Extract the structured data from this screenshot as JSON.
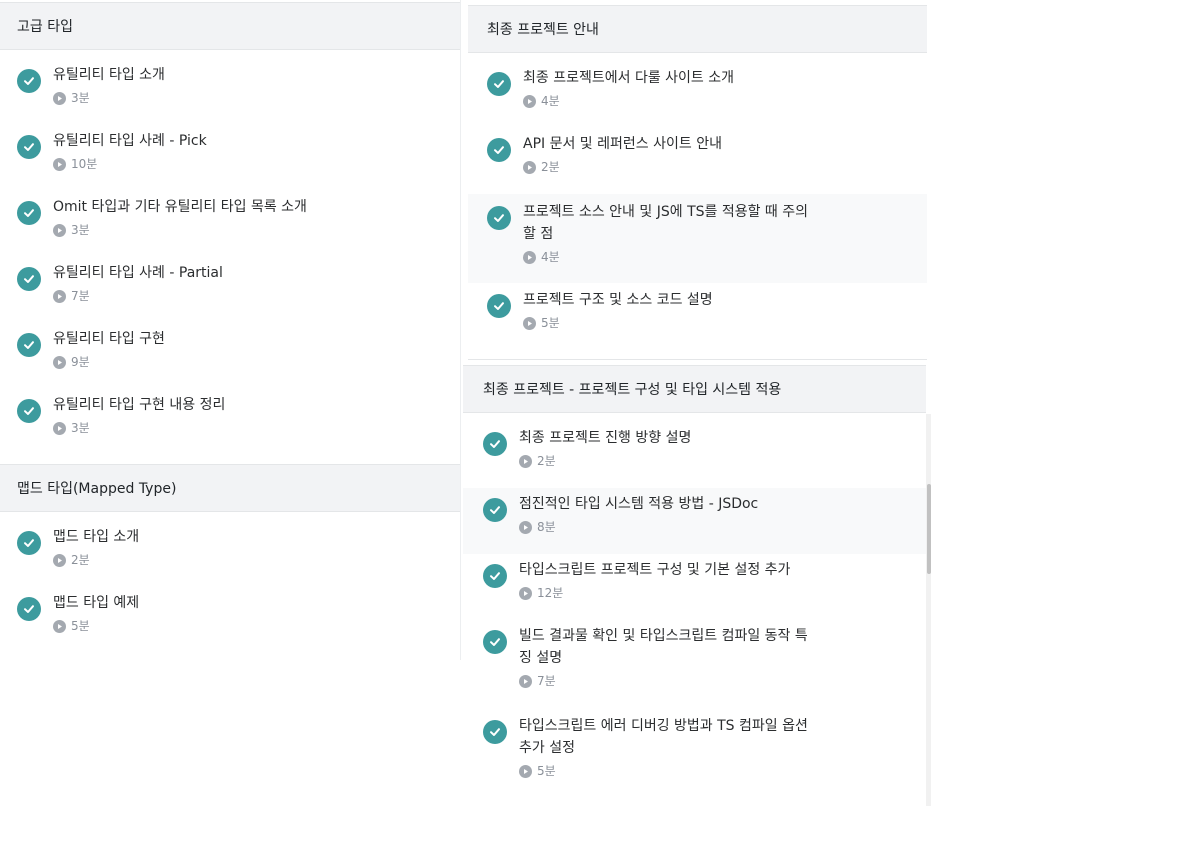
{
  "left": {
    "sections": [
      {
        "title": "고급 타입",
        "lectures": [
          {
            "title": "유틸리티 타입 소개",
            "duration": "3분"
          },
          {
            "title": "유틸리티 타입 사례 - Pick",
            "duration": "10분"
          },
          {
            "title": "Omit 타입과 기타 유틸리티 타입 목록 소개",
            "duration": "3분"
          },
          {
            "title": "유틸리티 타입 사례 - Partial",
            "duration": "7분"
          },
          {
            "title": "유틸리티 타입 구현",
            "duration": "9분"
          },
          {
            "title": "유틸리티 타입 구현 내용 정리",
            "duration": "3분"
          }
        ]
      },
      {
        "title": "맵드 타입(Mapped Type)",
        "lectures": [
          {
            "title": "맵드 타입 소개",
            "duration": "2분"
          },
          {
            "title": "맵드 타입 예제",
            "duration": "5분"
          }
        ]
      }
    ]
  },
  "right_top": {
    "title": "최종 프로젝트 안내",
    "lectures": [
      {
        "title": "최종 프로젝트에서 다룰 사이트 소개",
        "duration": "4분"
      },
      {
        "title": "API 문서 및 레퍼런스 사이트 안내",
        "duration": "2분"
      },
      {
        "title_line1": "프로젝트 소스 안내 및 JS에 TS를 적용할 때 주의",
        "title_line2": "할 점",
        "duration": "4분"
      },
      {
        "title": "프로젝트 구조 및 소스 코드 설명",
        "duration": "5분"
      }
    ]
  },
  "right_bottom": {
    "title": "최종 프로젝트 - 프로젝트 구성 및 타입 시스템 적용",
    "lectures": [
      {
        "title": "최종 프로젝트 진행 방향 설명",
        "duration": "2분"
      },
      {
        "title": "점진적인 타입 시스템 적용 방법 - JSDoc",
        "duration": "8분"
      },
      {
        "title": "타입스크립트 프로젝트 구성 및 기본 설정 추가",
        "duration": "12분"
      },
      {
        "title_line1": "빌드 결과물 확인 및 타입스크립트 컴파일 동작 특",
        "title_line2": "징 설명",
        "duration": "7분"
      },
      {
        "title_line1": "타입스크립트 에러 디버깅 방법과 TS 컴파일 옵션",
        "title_line2": "추가 설정",
        "duration": "5분"
      }
    ]
  },
  "colors": {
    "check": "#3d9b9e",
    "header_bg": "#f2f3f5",
    "highlight_bg": "#f8f9fa"
  }
}
